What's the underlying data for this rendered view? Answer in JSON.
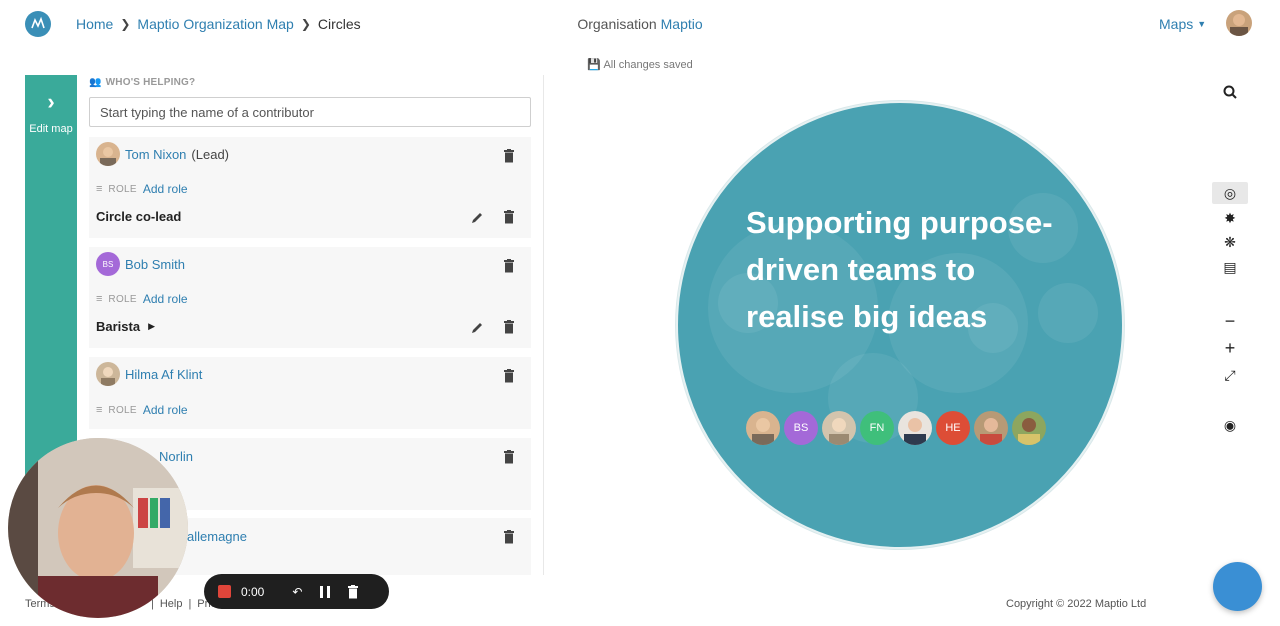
{
  "header": {
    "breadcrumbs": [
      "Home",
      "Maptio Organization Map",
      "Circles"
    ],
    "org_prefix": "Organisation",
    "org_name": "Maptio",
    "maps_label": "Maps",
    "save_status": "All changes saved"
  },
  "sidebar": {
    "edit_label": "Edit map"
  },
  "panel": {
    "section_title": "WHO'S HELPING?",
    "search_placeholder": "Start typing the name of a contributor",
    "role_label": "ROLE",
    "add_role": "Add role",
    "contributors": [
      {
        "name": "Tom Nixon",
        "suffix": "(Lead)",
        "role": "Circle co-lead"
      },
      {
        "name": "Bob Smith",
        "initials": "BS",
        "role": "Barista"
      },
      {
        "name": "Hilma Af Klint"
      },
      {
        "name": "Norlin"
      },
      {
        "name": "allemagne"
      }
    ]
  },
  "map": {
    "headline": "Supporting purpose-driven teams to realise big ideas",
    "members": [
      {
        "type": "photo"
      },
      {
        "initials": "BS",
        "color": "#a469d8"
      },
      {
        "type": "photo"
      },
      {
        "initials": "FN",
        "color": "#3fbf7b"
      },
      {
        "type": "photo"
      },
      {
        "initials": "HE",
        "color": "#dd4d36"
      },
      {
        "type": "photo"
      },
      {
        "type": "photo"
      }
    ],
    "circle_color": "#4aa2b2"
  },
  "footer": {
    "links": [
      "Terms",
      "Help",
      "Pric"
    ],
    "copyright": "Copyright © 2022 Maptio Ltd"
  },
  "recorder": {
    "time": "0:00"
  },
  "colors": {
    "accent": "#2f7fb0",
    "sidebar": "#3aaa9a",
    "record": "#e0453a"
  }
}
